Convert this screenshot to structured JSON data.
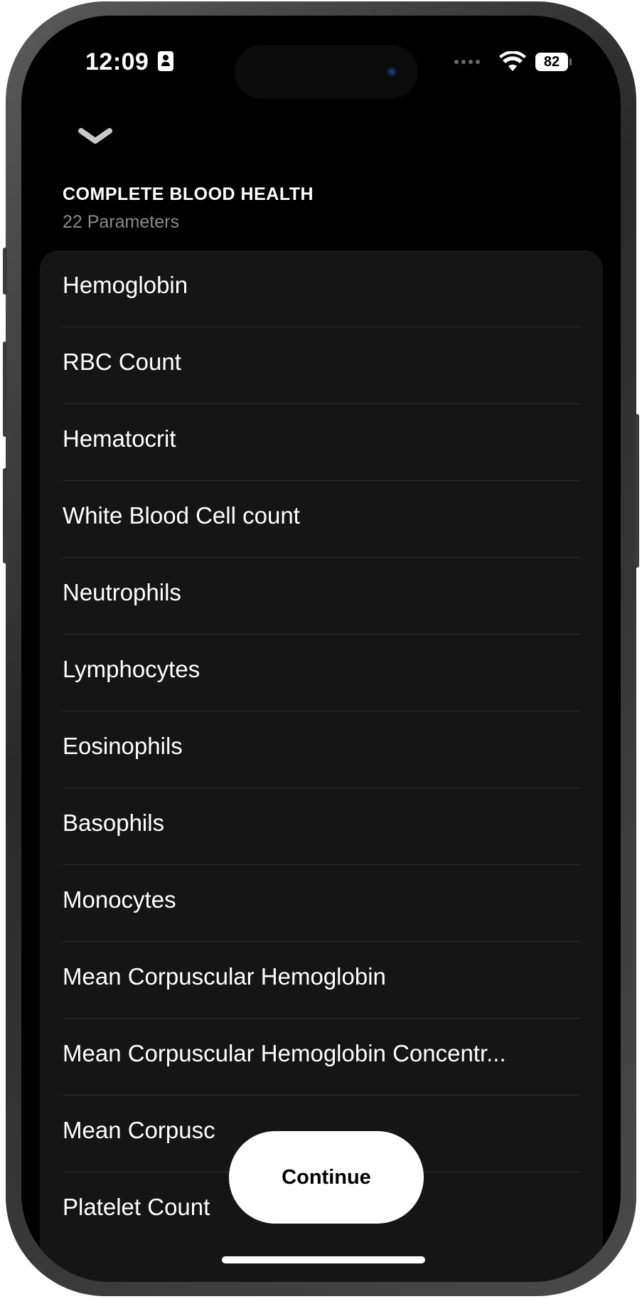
{
  "status_bar": {
    "time": "12:09",
    "battery": "82"
  },
  "header": {
    "title": "COMPLETE BLOOD HEALTH",
    "subtitle": "22 Parameters"
  },
  "parameters": [
    "Hemoglobin",
    "RBC Count",
    "Hematocrit",
    "White Blood Cell count",
    "Neutrophils",
    "Lymphocytes",
    "Eosinophils",
    "Basophils",
    "Monocytes",
    "Mean Corpuscular Hemoglobin",
    "Mean Corpuscular Hemoglobin Concentr...",
    "Mean Corpusc",
    "Platelet Count"
  ],
  "actions": {
    "continue_label": "Continue"
  },
  "colors": {
    "background": "#000000",
    "card": "#151515",
    "divider": "#2e2e2e",
    "secondary_text": "#8a8a8a"
  }
}
